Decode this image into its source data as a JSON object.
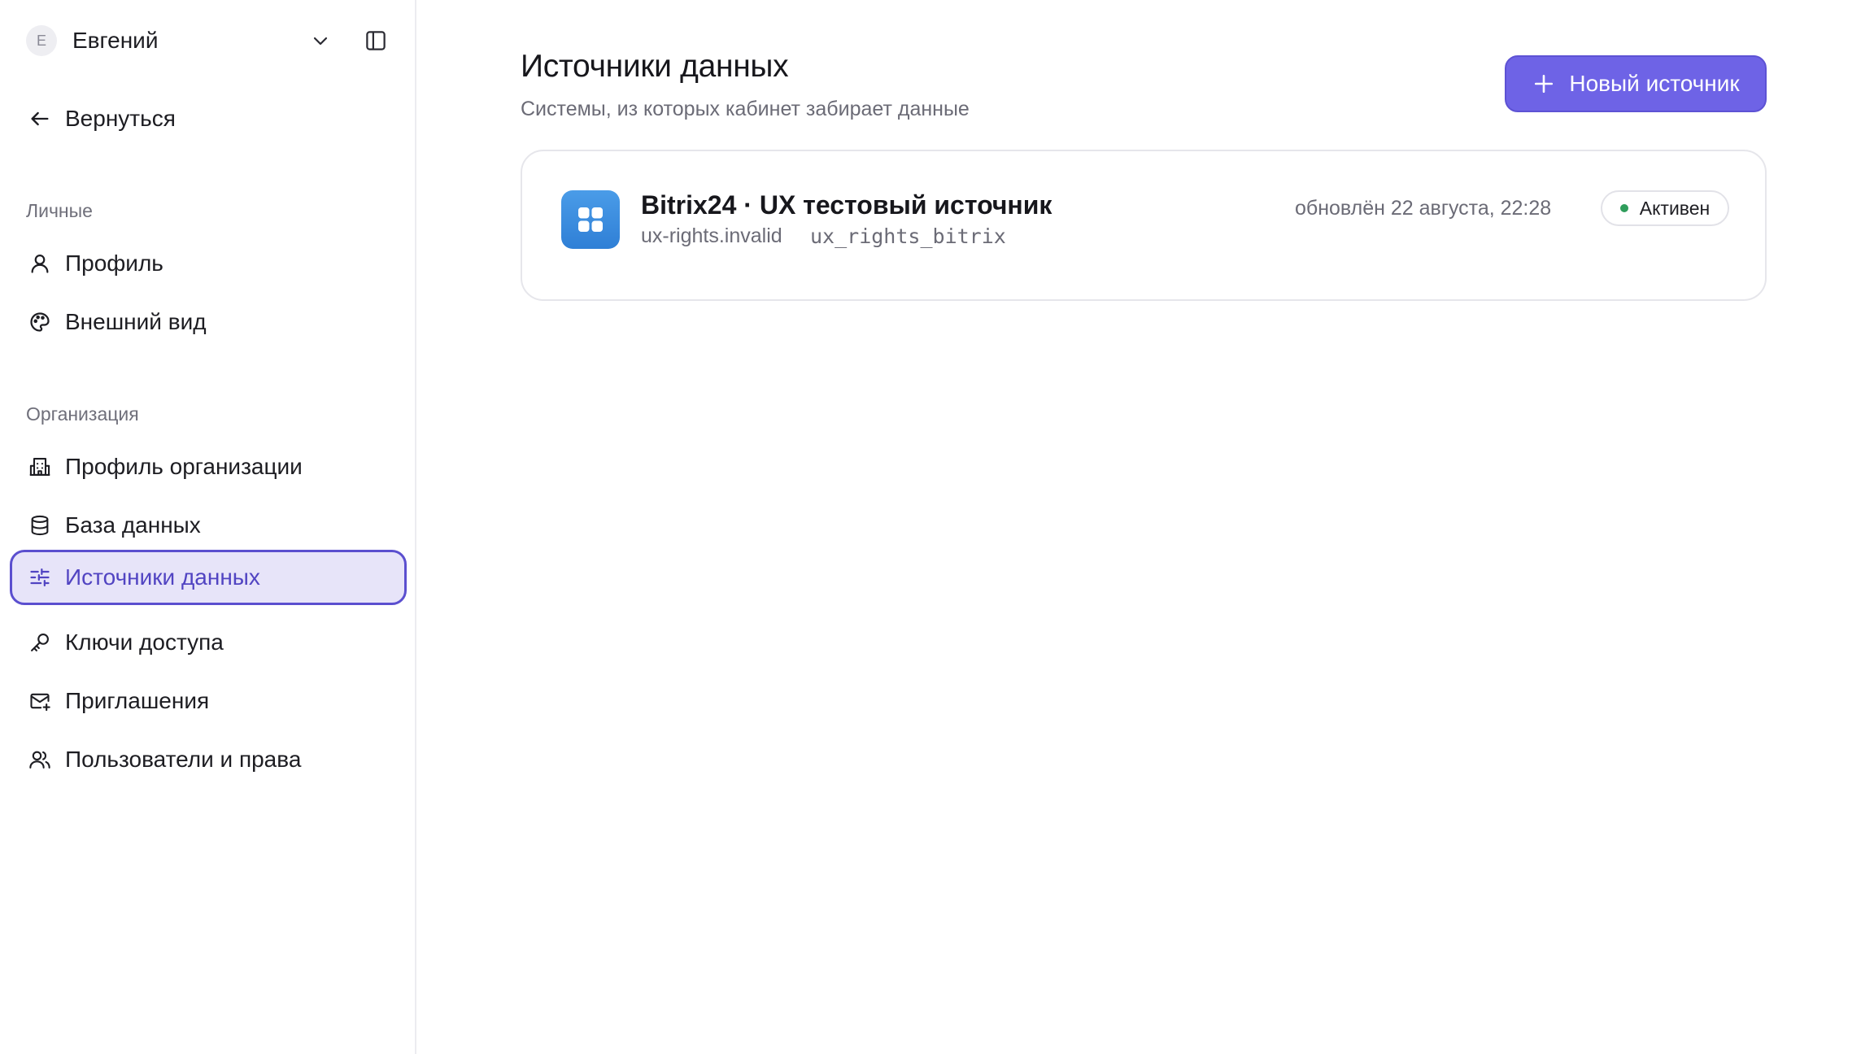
{
  "sidebar": {
    "user": {
      "initial": "Е",
      "name": "Евгений"
    },
    "back_label": "Вернуться",
    "personal_section": {
      "title": "Личные",
      "items": [
        {
          "label": "Профиль",
          "icon": "user-icon"
        },
        {
          "label": "Внешний вид",
          "icon": "palette-icon"
        }
      ]
    },
    "org_section": {
      "title": "Организация",
      "items": [
        {
          "label": "Профиль организации",
          "icon": "building-icon"
        },
        {
          "label": "База данных",
          "icon": "database-icon"
        },
        {
          "label": "Источники данных",
          "icon": "sliders-icon",
          "active": true
        },
        {
          "label": "Ключи доступа",
          "icon": "key-icon"
        },
        {
          "label": "Приглашения",
          "icon": "mail-plus-icon"
        },
        {
          "label": "Пользователи и права",
          "icon": "users-icon"
        }
      ]
    }
  },
  "main": {
    "title": "Источники данных",
    "subtitle": "Системы, из которых кабинет забирает данные",
    "new_button_label": "Новый источник",
    "sources": [
      {
        "title": "Bitrix24 · UX тестовый источник",
        "domain": "ux-rights.invalid",
        "slug": "ux_rights_bitrix",
        "updated": "обновлён 22 августа, 22:28",
        "status": "Активен",
        "icon": "bitrix-grid-icon"
      }
    ]
  },
  "colors": {
    "accent": "#6e63e6",
    "active_nav_bg": "#e7e4f9",
    "active_nav_border": "#5b4fcf",
    "status_active": "#2f9d5b",
    "app_icon": "#3b8ee0"
  }
}
